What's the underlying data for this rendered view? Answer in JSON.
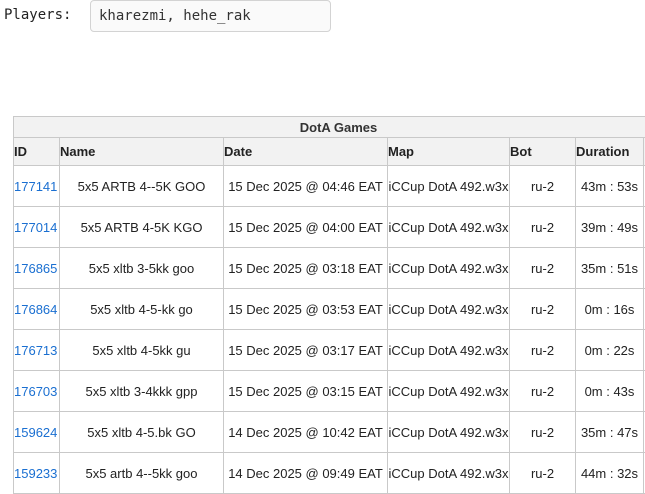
{
  "players": {
    "label": "Players:",
    "value": "kharezmi, hehe_rak"
  },
  "table": {
    "caption": "DotA Games",
    "columns": [
      "ID",
      "Name",
      "Date",
      "Map",
      "Bot",
      "Duration"
    ],
    "rows": [
      {
        "id": "177141",
        "name": "5x5 ARTB 4--5K GOO",
        "date": "15 Dec 2025 @ 04:46 EAT",
        "map": "iCCup DotA 492.w3x",
        "bot": "ru-2",
        "duration": "43m : 53s"
      },
      {
        "id": "177014",
        "name": "5x5 ARTB 4-5K KGO",
        "date": "15 Dec 2025 @ 04:00 EAT",
        "map": "iCCup DotA 492.w3x",
        "bot": "ru-2",
        "duration": "39m : 49s"
      },
      {
        "id": "176865",
        "name": "5x5 xltb 3-5kk goo",
        "date": "15 Dec 2025 @ 03:18 EAT",
        "map": "iCCup DotA 492.w3x",
        "bot": "ru-2",
        "duration": "35m : 51s"
      },
      {
        "id": "176864",
        "name": "5x5 xltb 4-5-kk go",
        "date": "15 Dec 2025 @ 03:53 EAT",
        "map": "iCCup DotA 492.w3x",
        "bot": "ru-2",
        "duration": "0m : 16s"
      },
      {
        "id": "176713",
        "name": "5x5 xltb 4-5kk gu",
        "date": "15 Dec 2025 @ 03:17 EAT",
        "map": "iCCup DotA 492.w3x",
        "bot": "ru-2",
        "duration": "0m : 22s"
      },
      {
        "id": "176703",
        "name": "5x5 xltb 3-4kkk gpp",
        "date": "15 Dec 2025 @ 03:15 EAT",
        "map": "iCCup DotA 492.w3x",
        "bot": "ru-2",
        "duration": "0m : 43s"
      },
      {
        "id": "159624",
        "name": "5x5 xltb 4-5.bk GO",
        "date": "14 Dec 2025 @ 10:42 EAT",
        "map": "iCCup DotA 492.w3x",
        "bot": "ru-2",
        "duration": "35m : 47s"
      },
      {
        "id": "159233",
        "name": "5x5 artb 4--5kk goo",
        "date": "14 Dec 2025 @ 09:49 EAT",
        "map": "iCCup DotA 492.w3x",
        "bot": "ru-2",
        "duration": "44m : 32s"
      }
    ]
  },
  "colors": {
    "link": "#1a6fd1",
    "header_bg": "#f2f2f2",
    "border": "#c9c9c9"
  }
}
